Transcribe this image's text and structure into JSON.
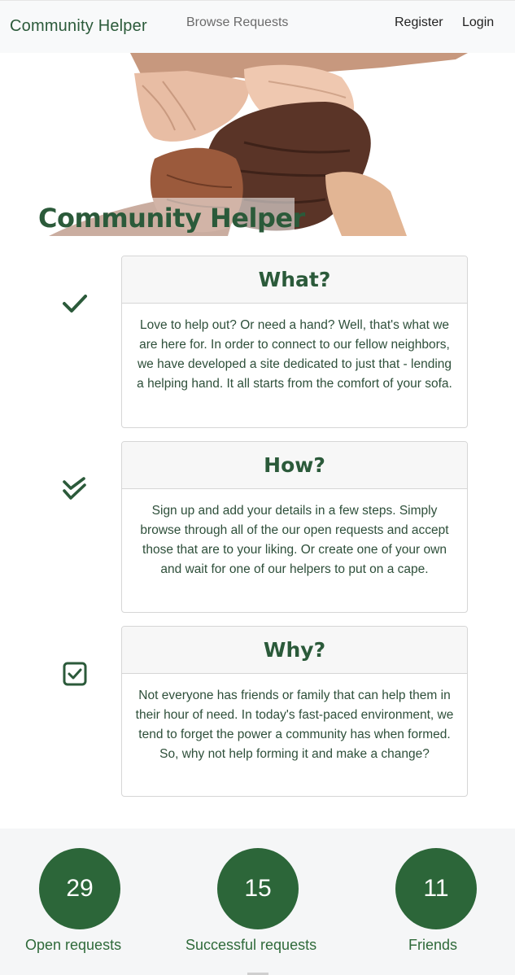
{
  "nav": {
    "brand": "Community Helper",
    "browse": "Browse Requests",
    "register": "Register",
    "login": "Login"
  },
  "hero": {
    "title": "Community Helper"
  },
  "cards": [
    {
      "icon": "check-icon",
      "title": "What?",
      "body": "Love to help out? Or need a hand? Well, that's what we are here for. In order to connect to our fellow neighbors, we have developed a site dedicated to just that - lending a helping hand. It all starts from the comfort of your sofa."
    },
    {
      "icon": "double-check-icon",
      "title": "How?",
      "body": "Sign up and add your details in a few steps. Simply browse through all of the our open requests and accept those that are to your liking. Or create one of your own and wait for one of our helpers to put on a cape."
    },
    {
      "icon": "checkbox-icon",
      "title": "Why?",
      "body": "Not everyone has friends or family that can help them in their hour of need. In today's fast-paced environment, we tend to forget the power a community has when formed. So, why not help forming it and make a change?"
    }
  ],
  "stats": [
    {
      "value": "29",
      "label": "Open requests"
    },
    {
      "value": "15",
      "label": "Successful requests"
    },
    {
      "value": "11",
      "label": "Friends"
    }
  ],
  "colors": {
    "primary": "#2b5a3a",
    "circle": "#2c6639",
    "navbar_bg": "#f8f9fa",
    "card_header_bg": "#f7f7f7",
    "stats_bg": "#f5f6f7"
  }
}
